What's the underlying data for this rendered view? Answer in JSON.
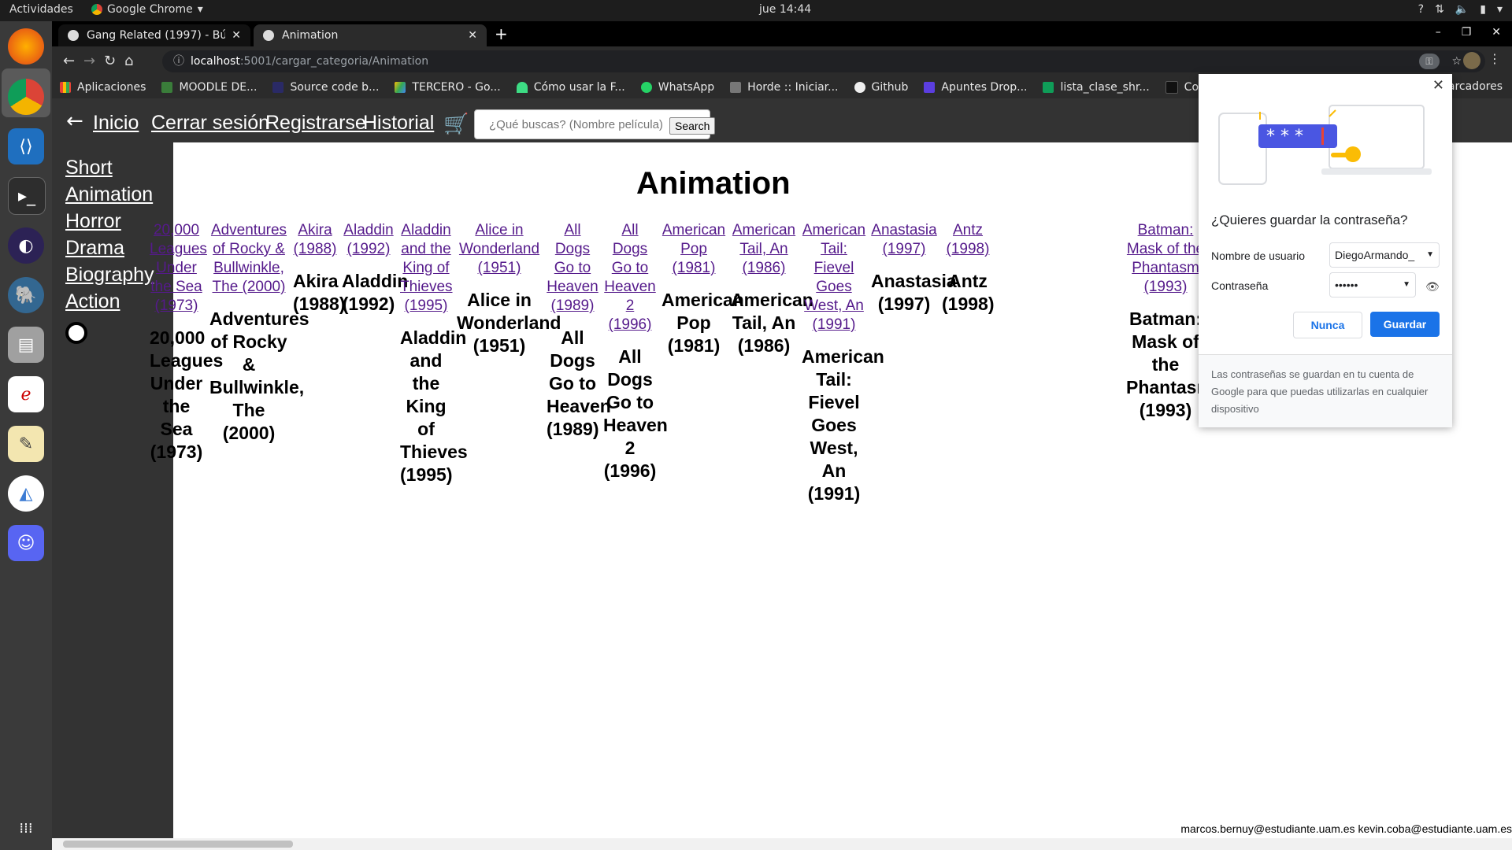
{
  "topbar": {
    "activities": "Actividades",
    "app_name": "Google Chrome",
    "clock": "jue 14:44"
  },
  "browser": {
    "tabs": [
      {
        "title": "Gang Related (1997) - Bús",
        "active": false
      },
      {
        "title": "Animation",
        "active": true
      }
    ],
    "url_host": "localhost",
    "url_path": ":5001/cargar_categoria/Animation",
    "bookmarks": [
      "Aplicaciones",
      "MOODLE DE...",
      "Source code b...",
      "TERCERO - Go...",
      "Cómo usar la F...",
      "WhatsApp",
      "Horde :: Iniciar...",
      "Github",
      "Apuntes Drop...",
      "lista_clase_shr...",
      "Co"
    ],
    "bookmarks_right": "arcadores"
  },
  "nav": {
    "links": [
      "Inicio",
      "Cerrar sesión",
      "Registrarse",
      "Historial"
    ],
    "search_placeholder": "¿Qué buscas? (Nombre película)",
    "search_button": "Search"
  },
  "sidebar": {
    "categories": [
      "Short",
      "Animation",
      "Horror",
      "Drama",
      "Biography",
      "Action"
    ]
  },
  "main": {
    "heading": "Animation",
    "movies": [
      {
        "img_alt": "20,000 Leagues Under the Sea (1973)",
        "title": "20,000 Leagues Under the Sea (1973)"
      },
      {
        "img_alt": "Adventures of Rocky & Bullwinkle, The (2000)",
        "title": "Adventures of Rocky & Bullwinkle, The (2000)"
      },
      {
        "img_alt": "Akira (1988)",
        "title": "Akira (1988)"
      },
      {
        "img_alt": "Aladdin (1992)",
        "title": "Aladdin (1992)"
      },
      {
        "img_alt": "Aladdin and the King of Thieves (1995)",
        "title": "Aladdin and the King of Thieves (1995)"
      },
      {
        "img_alt": "Alice in Wonderland (1951)",
        "title": "Alice in Wonderland (1951)"
      },
      {
        "img_alt": "All Dogs Go to Heaven (1989)",
        "title": "All Dogs Go to Heaven (1989)"
      },
      {
        "img_alt": "All Dogs Go to Heaven 2 (1996)",
        "title": "All Dogs Go to Heaven 2 (1996)"
      },
      {
        "img_alt": "American Pop (1981)",
        "title": "American Pop (1981)"
      },
      {
        "img_alt": "American Tail, An (1986)",
        "title": "American Tail, An (1986)"
      },
      {
        "img_alt": "American Tail: Fievel Goes West, An (1991)",
        "title": "American Tail: Fievel Goes West, An (1991)"
      },
      {
        "img_alt": "Anastasia (1997)",
        "title": "Anastasia (1997)"
      },
      {
        "img_alt": "Antz (1998)",
        "title": "Antz (1998)"
      },
      {
        "img_alt": "Batman: Mask of the Phantasm (1993)",
        "title": "Batman: Mask of the Phantasm (1993)"
      }
    ],
    "footer": "marcos.bernuy@estudiante.uam.es kevin.coba@estudiante.uam.es"
  },
  "password_popup": {
    "question": "¿Quieres guardar la contraseña?",
    "username_label": "Nombre de usuario",
    "username_value": "DiegoArmando_",
    "password_label": "Contraseña",
    "password_value": "••••••",
    "never_button": "Nunca",
    "save_button": "Guardar",
    "footer_text": "Las contraseñas se guardan en tu cuenta de Google para que puedas utilizarlas en cualquier dispositivo"
  }
}
